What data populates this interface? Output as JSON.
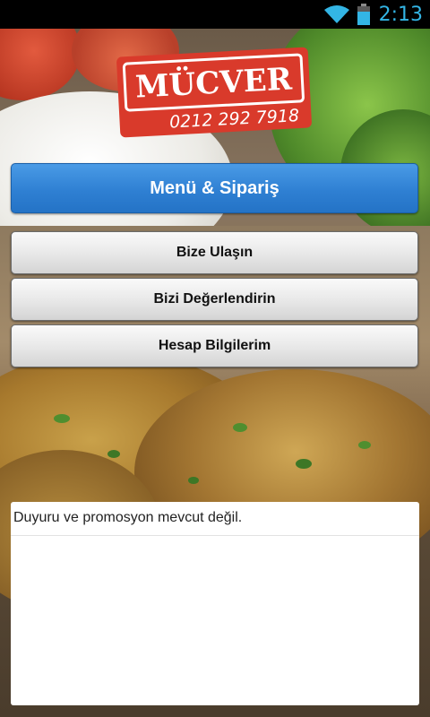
{
  "status_bar": {
    "time": "2:13",
    "icons": [
      "wifi-icon",
      "battery-icon"
    ],
    "accent_color": "#33b5e5"
  },
  "logo": {
    "name": "MÜCVER",
    "phone": "0212 292 7918",
    "color": "#d93a2b"
  },
  "menu": {
    "primary_label": "Menü & Sipariş",
    "contact_label": "Bize Ulaşın",
    "rate_label": "Bizi Değerlendirin",
    "account_label": "Hesap Bilgilerim",
    "primary_color": "#2f80d3"
  },
  "announcements": {
    "empty_text": "Duyuru ve promosyon mevcut değil."
  }
}
